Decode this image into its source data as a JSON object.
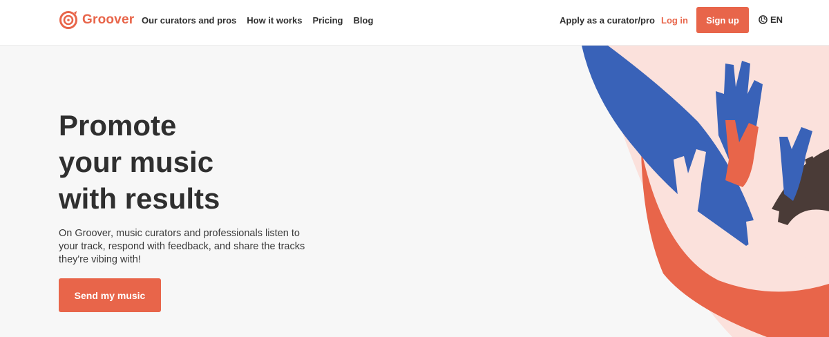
{
  "header": {
    "logo_text": "Groover",
    "nav": [
      "Our curators and pros",
      "How it works",
      "Pricing",
      "Blog"
    ],
    "apply_label": "Apply as a curator/pro",
    "login_label": "Log in",
    "signup_label": "Sign up",
    "lang_label": "EN"
  },
  "hero": {
    "title_lines": [
      "Promote",
      "your music",
      "with results"
    ],
    "description": "On Groover, music curators and professionals listen to your track, respond with feedback, and share the tracks they're vibing with!",
    "cta_label": "Send my music"
  },
  "colors": {
    "brand": "#e8654a",
    "text": "#2f2f2f",
    "background": "#f7f7f7",
    "illustration_blue": "#3962b8",
    "illustration_pink": "#fbe1dc",
    "illustration_dark": "#4a3b37"
  },
  "icons": {
    "logo": "groover-logo-icon",
    "language": "globe-icon"
  }
}
